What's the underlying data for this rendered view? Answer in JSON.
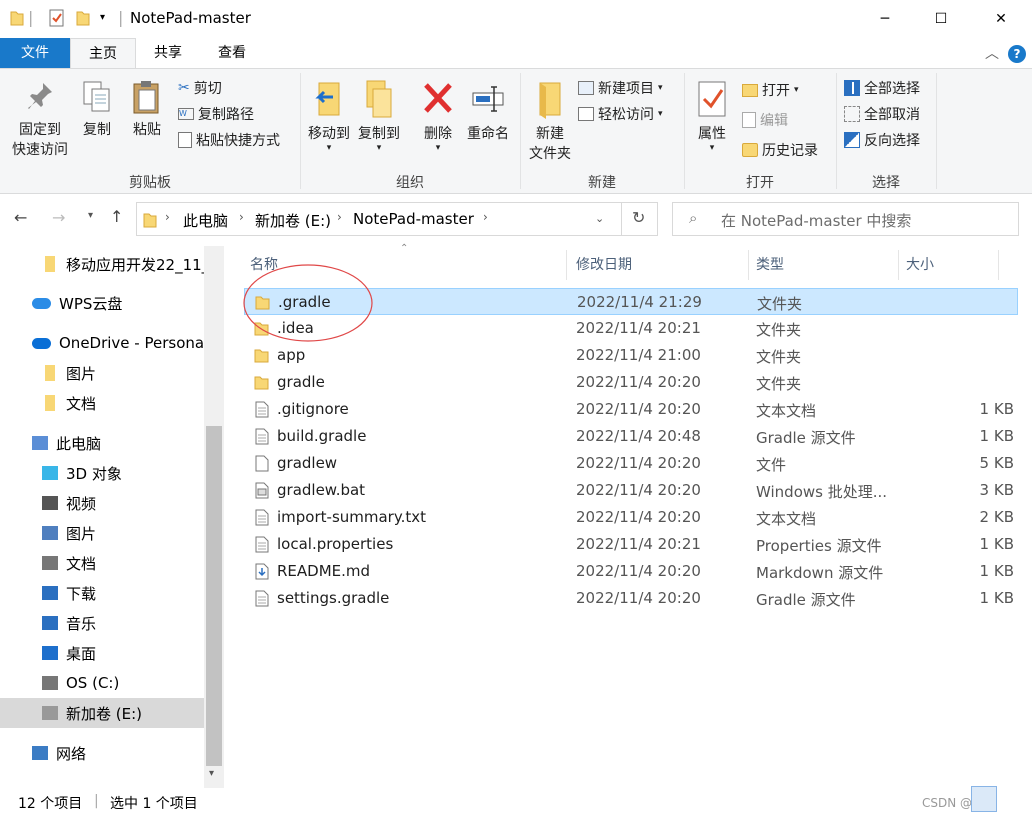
{
  "window": {
    "title": "NotePad-master",
    "controls": {
      "minimize": "─",
      "maximize": "☐",
      "close": "✕"
    }
  },
  "tabs": [
    {
      "label": "文件"
    },
    {
      "label": "主页"
    },
    {
      "label": "共享"
    },
    {
      "label": "查看"
    }
  ],
  "ribbon": {
    "clipboard": {
      "pin": "固定到",
      "pin2": "快速访问",
      "copy": "复制",
      "paste": "粘贴",
      "cut": "剪切",
      "copy_path": "复制路径",
      "paste_shortcut": "粘贴快捷方式",
      "label": "剪贴板"
    },
    "organize": {
      "move_to": "移动到",
      "copy_to": "复制到",
      "delete": "删除",
      "rename": "重命名",
      "label": "组织"
    },
    "new": {
      "new_folder": "新建",
      "new_folder2": "文件夹",
      "new_item": "新建项目",
      "easy_access": "轻松访问",
      "label": "新建"
    },
    "open": {
      "properties": "属性",
      "open": "打开",
      "edit": "编辑",
      "history": "历史记录",
      "label": "打开"
    },
    "select": {
      "select_all": "全部选择",
      "select_none": "全部取消",
      "invert": "反向选择",
      "label": "选择"
    }
  },
  "address": {
    "crumbs": [
      "此电脑",
      "新加卷 (E:)",
      "NotePad-master"
    ],
    "search_placeholder": "在 NotePad-master 中搜索"
  },
  "nav": [
    {
      "label": "移动应用开发22_11_",
      "icon": "folder-icon",
      "indent": 1
    },
    {
      "label": "WPS云盘",
      "icon": "cloud-icon",
      "indent": 0
    },
    {
      "label": "OneDrive - Personal",
      "icon": "onedrive-icon",
      "indent": 0
    },
    {
      "label": "图片",
      "icon": "folder-icon",
      "indent": 1
    },
    {
      "label": "文档",
      "icon": "folder-icon",
      "indent": 1
    },
    {
      "label": "此电脑",
      "icon": "pc-icon",
      "indent": 0
    },
    {
      "label": "3D 对象",
      "icon": "cube-icon",
      "indent": 1
    },
    {
      "label": "视频",
      "icon": "video-icon",
      "indent": 1
    },
    {
      "label": "图片",
      "icon": "picture-icon",
      "indent": 1
    },
    {
      "label": "文档",
      "icon": "document-icon",
      "indent": 1
    },
    {
      "label": "下载",
      "icon": "download-icon",
      "indent": 1
    },
    {
      "label": "音乐",
      "icon": "music-icon",
      "indent": 1
    },
    {
      "label": "桌面",
      "icon": "desktop-icon",
      "indent": 1
    },
    {
      "label": "OS (C:)",
      "icon": "drive-c-icon",
      "indent": 1
    },
    {
      "label": "新加卷 (E:)",
      "icon": "drive-e-icon",
      "indent": 1
    },
    {
      "label": "网络",
      "icon": "network-icon",
      "indent": 0
    }
  ],
  "columns": {
    "name": "名称",
    "date": "修改日期",
    "type": "类型",
    "size": "大小"
  },
  "files": [
    {
      "name": ".gradle",
      "date": "2022/11/4 21:29",
      "type": "文件夹",
      "size": "",
      "icon": "folder"
    },
    {
      "name": ".idea",
      "date": "2022/11/4 20:21",
      "type": "文件夹",
      "size": "",
      "icon": "folder"
    },
    {
      "name": "app",
      "date": "2022/11/4 21:00",
      "type": "文件夹",
      "size": "",
      "icon": "folder"
    },
    {
      "name": "gradle",
      "date": "2022/11/4 20:20",
      "type": "文件夹",
      "size": "",
      "icon": "folder"
    },
    {
      "name": ".gitignore",
      "date": "2022/11/4 20:20",
      "type": "文本文档",
      "size": "1 KB",
      "icon": "text"
    },
    {
      "name": "build.gradle",
      "date": "2022/11/4 20:48",
      "type": "Gradle 源文件",
      "size": "1 KB",
      "icon": "text"
    },
    {
      "name": "gradlew",
      "date": "2022/11/4 20:20",
      "type": "文件",
      "size": "5 KB",
      "icon": "blank"
    },
    {
      "name": "gradlew.bat",
      "date": "2022/11/4 20:20",
      "type": "Windows 批处理...",
      "size": "3 KB",
      "icon": "bat"
    },
    {
      "name": "import-summary.txt",
      "date": "2022/11/4 20:20",
      "type": "文本文档",
      "size": "2 KB",
      "icon": "text"
    },
    {
      "name": "local.properties",
      "date": "2022/11/4 20:21",
      "type": "Properties 源文件",
      "size": "1 KB",
      "icon": "text"
    },
    {
      "name": "README.md",
      "date": "2022/11/4 20:20",
      "type": "Markdown 源文件",
      "size": "1 KB",
      "icon": "md"
    },
    {
      "name": "settings.gradle",
      "date": "2022/11/4 20:20",
      "type": "Gradle 源文件",
      "size": "1 KB",
      "icon": "text"
    }
  ],
  "status": {
    "count": "12 个项目",
    "selected": "选中 1 个项目",
    "watermark": "CSDN @辰"
  },
  "colors": {
    "accent": "#1979ca",
    "selected_row": "#cce8ff",
    "folder": "#f8d775",
    "annotation_circle": "#e04848"
  }
}
